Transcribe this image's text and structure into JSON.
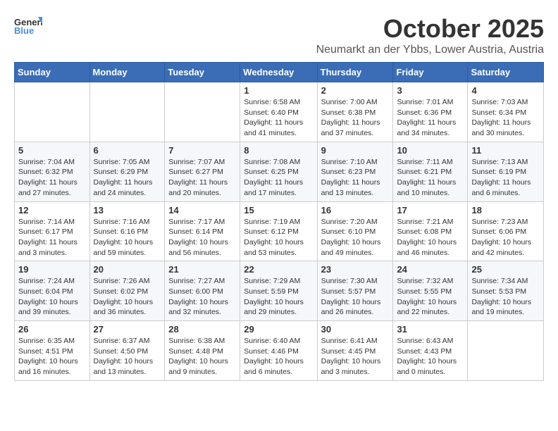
{
  "logo": {
    "general": "General",
    "blue": "Blue"
  },
  "title": "October 2025",
  "location": "Neumarkt an der Ybbs, Lower Austria, Austria",
  "weekdays": [
    "Sunday",
    "Monday",
    "Tuesday",
    "Wednesday",
    "Thursday",
    "Friday",
    "Saturday"
  ],
  "weeks": [
    [
      {
        "day": "",
        "info": ""
      },
      {
        "day": "",
        "info": ""
      },
      {
        "day": "",
        "info": ""
      },
      {
        "day": "1",
        "info": "Sunrise: 6:58 AM\nSunset: 6:40 PM\nDaylight: 11 hours\nand 41 minutes."
      },
      {
        "day": "2",
        "info": "Sunrise: 7:00 AM\nSunset: 6:38 PM\nDaylight: 11 hours\nand 37 minutes."
      },
      {
        "day": "3",
        "info": "Sunrise: 7:01 AM\nSunset: 6:36 PM\nDaylight: 11 hours\nand 34 minutes."
      },
      {
        "day": "4",
        "info": "Sunrise: 7:03 AM\nSunset: 6:34 PM\nDaylight: 11 hours\nand 30 minutes."
      }
    ],
    [
      {
        "day": "5",
        "info": "Sunrise: 7:04 AM\nSunset: 6:32 PM\nDaylight: 11 hours\nand 27 minutes."
      },
      {
        "day": "6",
        "info": "Sunrise: 7:05 AM\nSunset: 6:29 PM\nDaylight: 11 hours\nand 24 minutes."
      },
      {
        "day": "7",
        "info": "Sunrise: 7:07 AM\nSunset: 6:27 PM\nDaylight: 11 hours\nand 20 minutes."
      },
      {
        "day": "8",
        "info": "Sunrise: 7:08 AM\nSunset: 6:25 PM\nDaylight: 11 hours\nand 17 minutes."
      },
      {
        "day": "9",
        "info": "Sunrise: 7:10 AM\nSunset: 6:23 PM\nDaylight: 11 hours\nand 13 minutes."
      },
      {
        "day": "10",
        "info": "Sunrise: 7:11 AM\nSunset: 6:21 PM\nDaylight: 11 hours\nand 10 minutes."
      },
      {
        "day": "11",
        "info": "Sunrise: 7:13 AM\nSunset: 6:19 PM\nDaylight: 11 hours\nand 6 minutes."
      }
    ],
    [
      {
        "day": "12",
        "info": "Sunrise: 7:14 AM\nSunset: 6:17 PM\nDaylight: 11 hours\nand 3 minutes."
      },
      {
        "day": "13",
        "info": "Sunrise: 7:16 AM\nSunset: 6:16 PM\nDaylight: 10 hours\nand 59 minutes."
      },
      {
        "day": "14",
        "info": "Sunrise: 7:17 AM\nSunset: 6:14 PM\nDaylight: 10 hours\nand 56 minutes."
      },
      {
        "day": "15",
        "info": "Sunrise: 7:19 AM\nSunset: 6:12 PM\nDaylight: 10 hours\nand 53 minutes."
      },
      {
        "day": "16",
        "info": "Sunrise: 7:20 AM\nSunset: 6:10 PM\nDaylight: 10 hours\nand 49 minutes."
      },
      {
        "day": "17",
        "info": "Sunrise: 7:21 AM\nSunset: 6:08 PM\nDaylight: 10 hours\nand 46 minutes."
      },
      {
        "day": "18",
        "info": "Sunrise: 7:23 AM\nSunset: 6:06 PM\nDaylight: 10 hours\nand 42 minutes."
      }
    ],
    [
      {
        "day": "19",
        "info": "Sunrise: 7:24 AM\nSunset: 6:04 PM\nDaylight: 10 hours\nand 39 minutes."
      },
      {
        "day": "20",
        "info": "Sunrise: 7:26 AM\nSunset: 6:02 PM\nDaylight: 10 hours\nand 36 minutes."
      },
      {
        "day": "21",
        "info": "Sunrise: 7:27 AM\nSunset: 6:00 PM\nDaylight: 10 hours\nand 32 minutes."
      },
      {
        "day": "22",
        "info": "Sunrise: 7:29 AM\nSunset: 5:59 PM\nDaylight: 10 hours\nand 29 minutes."
      },
      {
        "day": "23",
        "info": "Sunrise: 7:30 AM\nSunset: 5:57 PM\nDaylight: 10 hours\nand 26 minutes."
      },
      {
        "day": "24",
        "info": "Sunrise: 7:32 AM\nSunset: 5:55 PM\nDaylight: 10 hours\nand 22 minutes."
      },
      {
        "day": "25",
        "info": "Sunrise: 7:34 AM\nSunset: 5:53 PM\nDaylight: 10 hours\nand 19 minutes."
      }
    ],
    [
      {
        "day": "26",
        "info": "Sunrise: 6:35 AM\nSunset: 4:51 PM\nDaylight: 10 hours\nand 16 minutes."
      },
      {
        "day": "27",
        "info": "Sunrise: 6:37 AM\nSunset: 4:50 PM\nDaylight: 10 hours\nand 13 minutes."
      },
      {
        "day": "28",
        "info": "Sunrise: 6:38 AM\nSunset: 4:48 PM\nDaylight: 10 hours\nand 9 minutes."
      },
      {
        "day": "29",
        "info": "Sunrise: 6:40 AM\nSunset: 4:46 PM\nDaylight: 10 hours\nand 6 minutes."
      },
      {
        "day": "30",
        "info": "Sunrise: 6:41 AM\nSunset: 4:45 PM\nDaylight: 10 hours\nand 3 minutes."
      },
      {
        "day": "31",
        "info": "Sunrise: 6:43 AM\nSunset: 4:43 PM\nDaylight: 10 hours\nand 0 minutes."
      },
      {
        "day": "",
        "info": ""
      }
    ]
  ]
}
